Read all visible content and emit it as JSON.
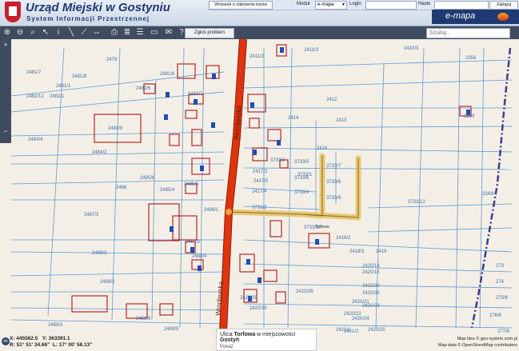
{
  "header": {
    "title": "Urząd Miejski w Gostyniu",
    "subtitle": "System Informacji Przestrzennej",
    "wniosek_label": "Wniosek o założenie konta",
    "modul_label": "Moduł",
    "modul_value": "e-mapa",
    "login_label": "Login",
    "haslo_label": "Hasło",
    "zaloguj_label": "Zaloguj",
    "logo_text": "e-mapa"
  },
  "toolbar": {
    "zglos_label": "Zgłoś problem",
    "search_placeholder": "Szukaj..."
  },
  "map": {
    "street_labels": [
      "Wrocławska",
      "Wrocławska",
      "Torfowa"
    ],
    "parcel_labels": [
      "2479",
      "2481/7",
      "2481/8",
      "2481/1",
      "2482/12",
      "2482/1",
      "2482/6",
      "2482/7",
      "2481/6",
      "2484/4",
      "2483/8",
      "2484/2",
      "2485/6",
      "2485/5",
      "2485/4",
      "2486",
      "2487/3",
      "2487/2",
      "2488/3",
      "2488/2",
      "2489/3",
      "2489/5",
      "2489/6",
      "2411/2",
      "2411/3",
      "2410/3",
      "2412",
      "2413",
      "2414",
      "2416",
      "2417/2",
      "2417/4",
      "2417/5",
      "2418/2",
      "2418/3",
      "2419",
      "2420/15",
      "2420/30",
      "2420/23",
      "2420/24",
      "2420/25",
      "2420/26",
      "2420/29",
      "2420/32",
      "2421/1",
      "2421/2",
      "2359",
      "2356",
      "3733/7",
      "3733/8",
      "3733/9",
      "3733/4",
      "3733/3",
      "3733/2",
      "3733/5",
      "3733/6",
      "3733/12",
      "3733/1",
      "3733/10",
      "2349/4",
      "273",
      "274",
      "275/6",
      "276/6",
      "277/6",
      "2420/18",
      "2420/20",
      "2420/21",
      "2420/22",
      "2486/1",
      "2488/4"
    ],
    "route_label": "Torfowa"
  },
  "status": {
    "x_label": "X: 445562.5",
    "y_label": "Y: 363391.1",
    "r_label": "R: 51° 51' 34.66\"",
    "l_label": "L: 17° 00' 56.13\"",
    "ok_label": "ok",
    "info_prefix": "Ulica",
    "info_street": "Torfowa",
    "info_middle": "w miejscowości",
    "info_town": "Gostyń",
    "info_link": "Pokaż",
    "tiles_line1": "Map tiles © geo-system.com.pl",
    "tiles_line2": "Map data © OpenStreetMap contributors"
  },
  "colors": {
    "road": "#e0340c",
    "route": "#e6c36a",
    "parcel_line": "#5b9bd5",
    "building": "#b3262a",
    "background": "#f4efe6",
    "boundary": "#3c3d8e"
  }
}
